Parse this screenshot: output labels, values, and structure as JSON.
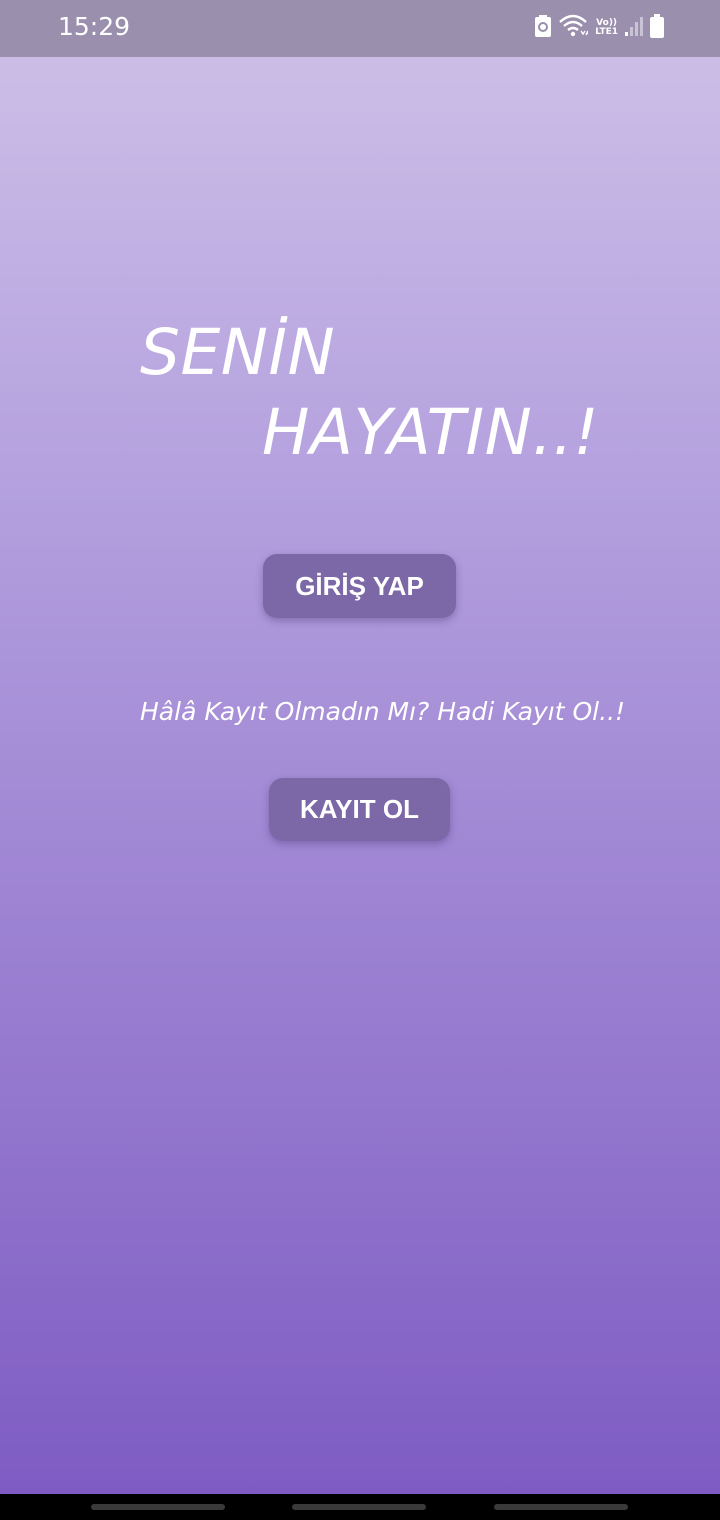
{
  "status_bar": {
    "time": "15:29",
    "lte_top": "Vo))",
    "lte_bottom": "LTE1",
    "icons": [
      "battery-saver-icon",
      "wifi-icon",
      "volte-lte-icon",
      "signal-icon",
      "battery-icon"
    ]
  },
  "hero": {
    "line1": "SENİN",
    "line2": "HAYATIN..!"
  },
  "login_button": {
    "label": "GİRİŞ YAP"
  },
  "register_prompt": "Hâlâ Kayıt Olmadın Mı? Hadi Kayıt Ol..!",
  "register_button": {
    "label": "KAYIT OL"
  },
  "colors": {
    "gradient_top": "#cfc1e8",
    "gradient_bottom": "#7e5cc3",
    "button_bg": "#7c68a6",
    "status_bar_bg": "#9a90ae"
  },
  "nav_bar": {
    "icons": [
      "recents-handle",
      "home-handle",
      "back-handle"
    ]
  }
}
